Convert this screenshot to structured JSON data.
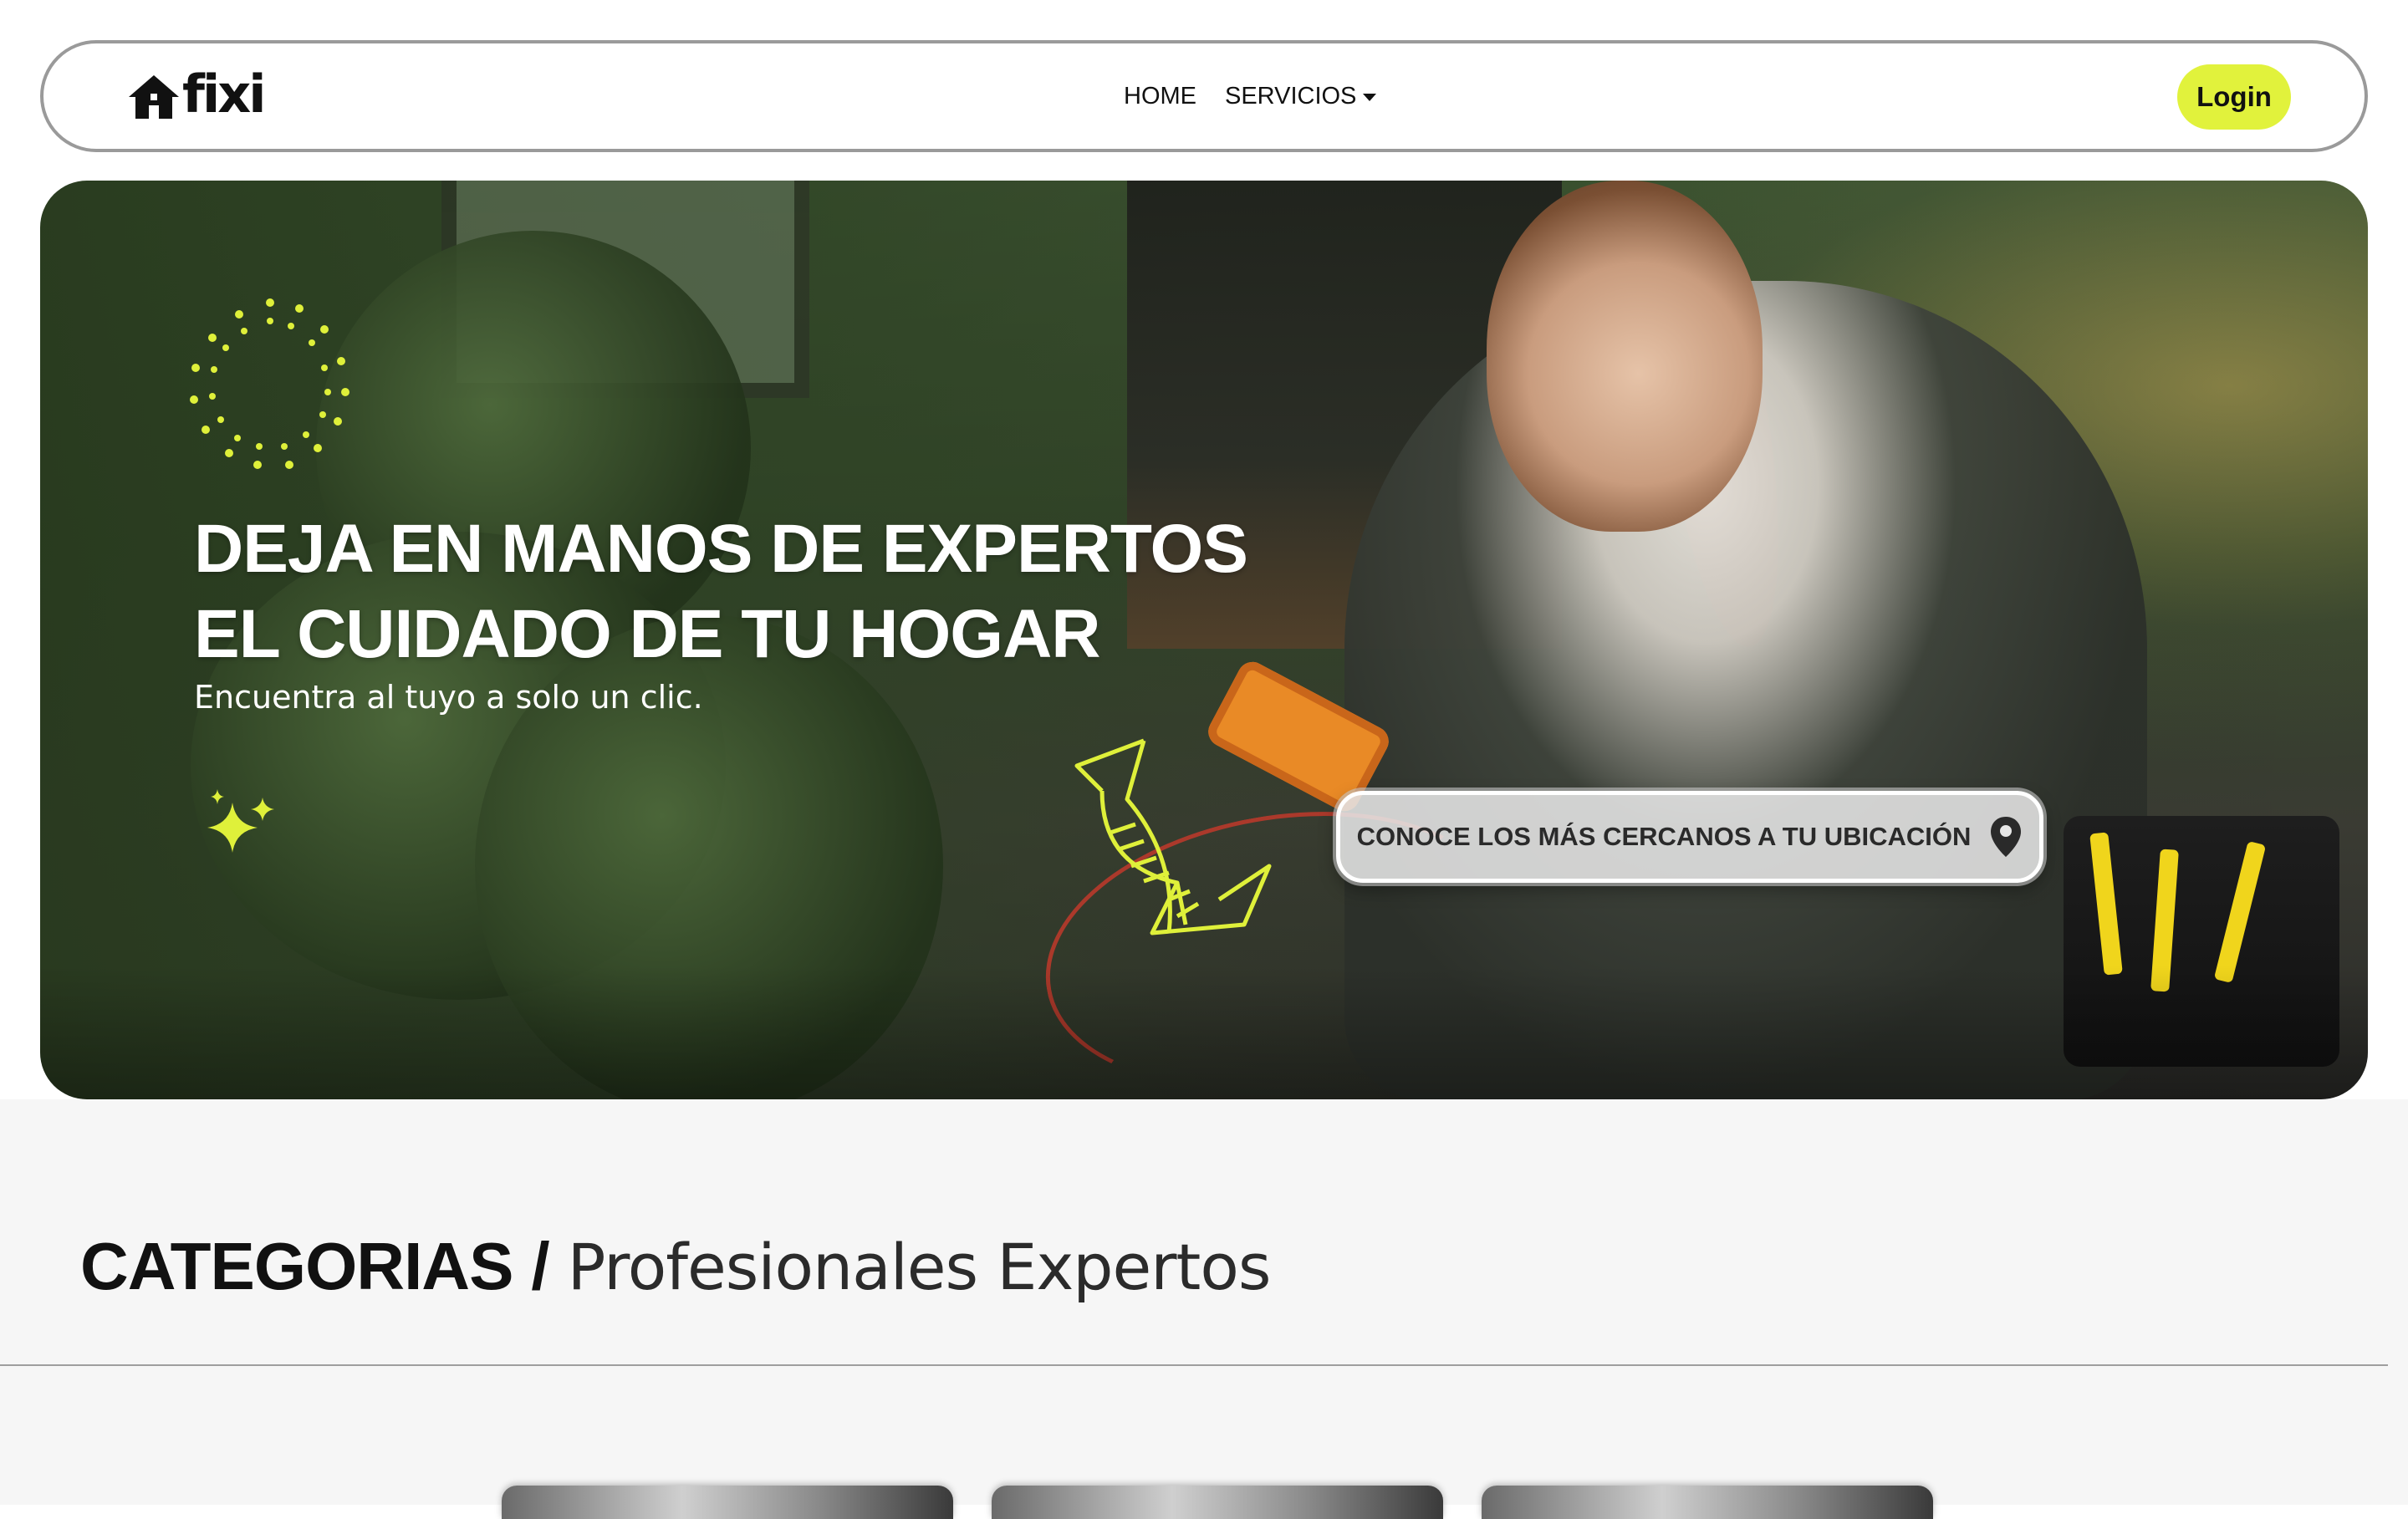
{
  "navbar": {
    "logo_text": "fixi",
    "links": [
      {
        "label": "HOME"
      },
      {
        "label": "SERVICIOS"
      }
    ],
    "login_label": "Login"
  },
  "hero": {
    "title_line1": "DEJA EN MANOS DE EXPERTOS",
    "title_line2": "EL CUIDADO DE TU HOGAR",
    "subtitle": "Encuentra al tuyo a solo un clic.",
    "cta_label": "CONOCE LOS MÁS CERCANOS A TU UBICACIÓN",
    "cta_icon": "location-pin-icon"
  },
  "categories": {
    "title_strong": "CATEGORIAS",
    "separator": "/",
    "title_light": "Profesionales Expertos",
    "cards_visible": 3
  },
  "colors": {
    "accent": "#e1f23c",
    "text_dark": "#111111",
    "section_bg": "#f6f6f6"
  }
}
